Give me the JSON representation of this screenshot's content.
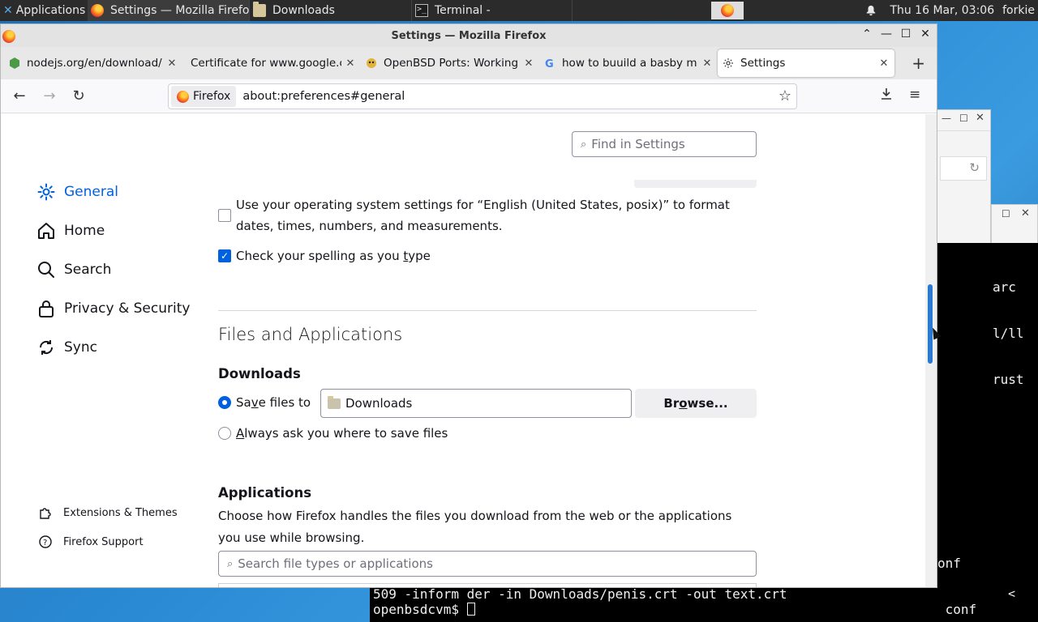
{
  "panel": {
    "apps_label": "Applications",
    "tasks": [
      {
        "label": "Settings — Mozilla Firefox",
        "icon": "firefox-icon"
      },
      {
        "label": "Downloads",
        "icon": "folder-icon"
      },
      {
        "label": "Terminal -",
        "icon": "terminal-icon"
      }
    ],
    "clock": "Thu 16 Mar, 03:06",
    "user": "forkie"
  },
  "window": {
    "title": "Settings — Mozilla Firefox"
  },
  "tabs": [
    {
      "label": "nodejs.org/en/download/",
      "icon": "nodejs-icon"
    },
    {
      "label": "Certificate for www.google.com",
      "icon": "none"
    },
    {
      "label": "OpenBSD Ports: Working with ports",
      "icon": "openbsd-icon"
    },
    {
      "label": "how to buuild a basby m",
      "icon": "google-icon"
    },
    {
      "label": "Settings",
      "icon": "gear-icon"
    }
  ],
  "urlbar": {
    "identity": "Firefox",
    "url": "about:preferences#general"
  },
  "sidebar": {
    "categories": [
      {
        "label": "General",
        "icon": "gear-icon",
        "selected": true
      },
      {
        "label": "Home",
        "icon": "home-icon"
      },
      {
        "label": "Search",
        "icon": "search-icon"
      },
      {
        "label": "Privacy & Security",
        "icon": "lock-icon"
      },
      {
        "label": "Sync",
        "icon": "sync-icon"
      }
    ],
    "footer": [
      {
        "label": "Extensions & Themes",
        "icon": "puzzle-icon"
      },
      {
        "label": "Firefox Support",
        "icon": "help-icon"
      }
    ]
  },
  "settings": {
    "find_placeholder": "Find in Settings",
    "os_locale_text_1": "Use your operating system settings for “English (United States, posix)” to format",
    "os_locale_text_2": "dates, times, numbers, and measurements.",
    "os_locale_checked": false,
    "spellcheck_pre": "Check your spelling as you ",
    "spellcheck_u": "t",
    "spellcheck_post": "ype",
    "spellcheck_checked": true,
    "files_heading": "Files and Applications",
    "downloads_heading": "Downloads",
    "save_files_pre": "Sa",
    "save_files_u": "v",
    "save_files_post": "e files to",
    "save_files_checked": true,
    "download_folder": "Downloads",
    "browse_pre": "Br",
    "browse_u": "o",
    "browse_post": "wse...",
    "always_ask_u": "A",
    "always_ask_post": "lways ask you where to save files",
    "always_ask_checked": false,
    "applications_heading": "Applications",
    "applications_desc": "Choose how Firefox handles the files you download from the web or the applications you use while browsing.",
    "search_apps_placeholder": "Search file types or applications"
  },
  "terminal": {
    "frag_lines": [
      "arc",
      "l/ll",
      "rust"
    ],
    "frag_lines2": [
      "onf",
      " conf"
    ],
    "line1": "509 -inform der -in Downloads/penis.crt -out text.crt",
    "prompt": "openbsdcvm$ ",
    "scroll_char": "<"
  }
}
